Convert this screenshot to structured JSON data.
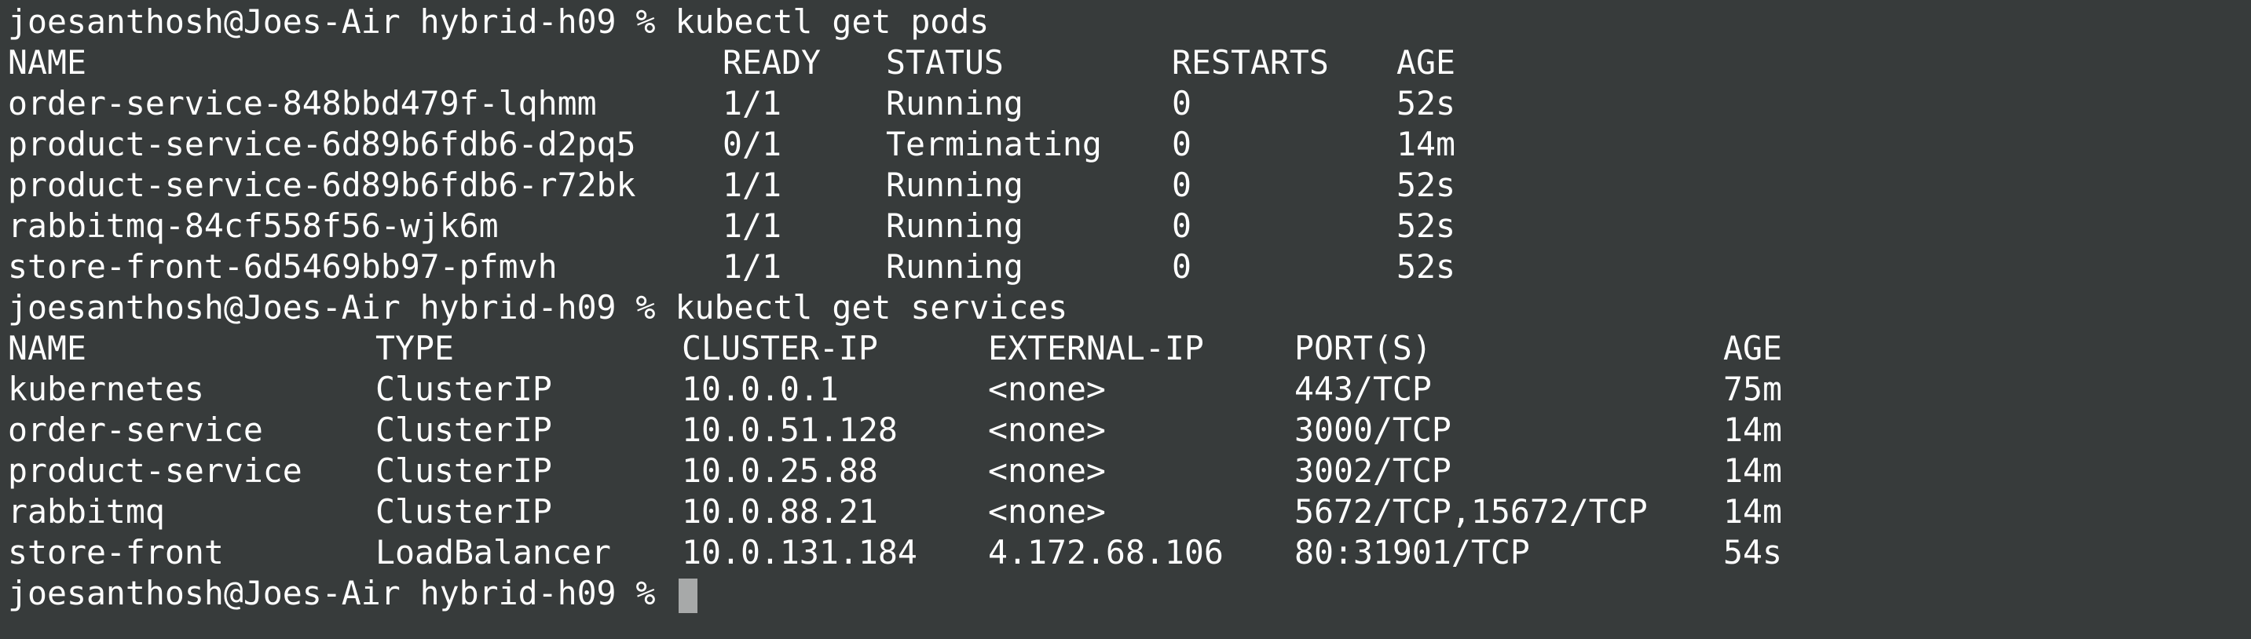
{
  "prompt": "joesanthosh@Joes-Air hybrid-h09 % ",
  "commands": {
    "pods": "kubectl get pods",
    "services": "kubectl get services"
  },
  "pods": {
    "headers": [
      "NAME",
      "READY",
      "STATUS",
      "RESTARTS",
      "AGE"
    ],
    "rows": [
      [
        "order-service-848bbd479f-lqhmm",
        "1/1",
        "Running",
        "0",
        "52s"
      ],
      [
        "product-service-6d89b6fdb6-d2pq5",
        "0/1",
        "Terminating",
        "0",
        "14m"
      ],
      [
        "product-service-6d89b6fdb6-r72bk",
        "1/1",
        "Running",
        "0",
        "52s"
      ],
      [
        "rabbitmq-84cf558f56-wjk6m",
        "1/1",
        "Running",
        "0",
        "52s"
      ],
      [
        "store-front-6d5469bb97-pfmvh",
        "1/1",
        "Running",
        "0",
        "52s"
      ]
    ]
  },
  "services": {
    "headers": [
      "NAME",
      "TYPE",
      "CLUSTER-IP",
      "EXTERNAL-IP",
      "PORT(S)",
      "AGE"
    ],
    "rows": [
      [
        "kubernetes",
        "ClusterIP",
        "10.0.0.1",
        "<none>",
        "443/TCP",
        "75m"
      ],
      [
        "order-service",
        "ClusterIP",
        "10.0.51.128",
        "<none>",
        "3000/TCP",
        "14m"
      ],
      [
        "product-service",
        "ClusterIP",
        "10.0.25.88",
        "<none>",
        "3002/TCP",
        "14m"
      ],
      [
        "rabbitmq",
        "ClusterIP",
        "10.0.88.21",
        "<none>",
        "5672/TCP,15672/TCP",
        "14m"
      ],
      [
        "store-front",
        "LoadBalancer",
        "10.0.131.184",
        "4.172.68.106",
        "80:31901/TCP",
        "54s"
      ]
    ]
  },
  "colors": {
    "background": "#373b3b",
    "text": "#ffffff",
    "cursor": "#a7a9a9"
  }
}
